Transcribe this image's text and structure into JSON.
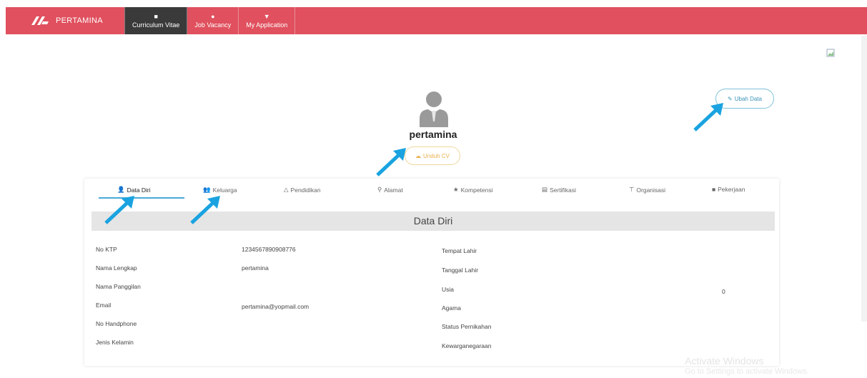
{
  "nav": {
    "brand": "PERTAMINA",
    "items": [
      {
        "label": "Curriculum Vitae",
        "icon": "briefcase-icon",
        "active": true
      },
      {
        "label": "Job Vacancy",
        "icon": "house-icon",
        "active": false
      },
      {
        "label": "My Application",
        "icon": "filter-icon",
        "active": false
      }
    ]
  },
  "profile": {
    "name": "pertamina",
    "unduh_label": "Unduh CV",
    "ubah_label": "Ubah Data"
  },
  "tabs": [
    {
      "label": "Data Diri",
      "icon": "user-icon"
    },
    {
      "label": "Keluarga",
      "icon": "users-icon"
    },
    {
      "label": "Pendidikan",
      "icon": "graduation-cap-icon"
    },
    {
      "label": "Alamat",
      "icon": "map-marker-icon"
    },
    {
      "label": "Kompetensi",
      "icon": "star-icon"
    },
    {
      "label": "Sertifikasi",
      "icon": "certificate-icon"
    },
    {
      "label": "Organisasi",
      "icon": "sitemap-icon"
    },
    {
      "label": "Pekerjaan",
      "icon": "briefcase-icon"
    }
  ],
  "section_title": "Data Diri",
  "left_fields": [
    {
      "label": "No KTP",
      "value": "1234567890908776"
    },
    {
      "label": "Nama Lengkap",
      "value": "pertamina"
    },
    {
      "label": "Nama Panggilan",
      "value": ""
    },
    {
      "label": "Email",
      "value": "pertamina@yopmail.com"
    },
    {
      "label": "No Handphone",
      "value": ""
    },
    {
      "label": "Jenis Kelamin",
      "value": ""
    }
  ],
  "right_fields": [
    {
      "label": "Tempat Lahir",
      "value": ""
    },
    {
      "label": "Tanggal Lahir",
      "value": ""
    },
    {
      "label": "Usia",
      "value": "0"
    },
    {
      "label": "Agama",
      "value": ""
    },
    {
      "label": "Status Pernikahan",
      "value": ""
    },
    {
      "label": "Kewarganegaraan",
      "value": ""
    }
  ],
  "watermark": {
    "line1": "Activate Windows",
    "line2": "Go to Settings to activate Windows."
  },
  "colors": {
    "nav": "#e0505e",
    "active_nav": "#3a3a3a",
    "arrow": "#1aa3e0",
    "tab_underline": "#4aa8d8"
  }
}
